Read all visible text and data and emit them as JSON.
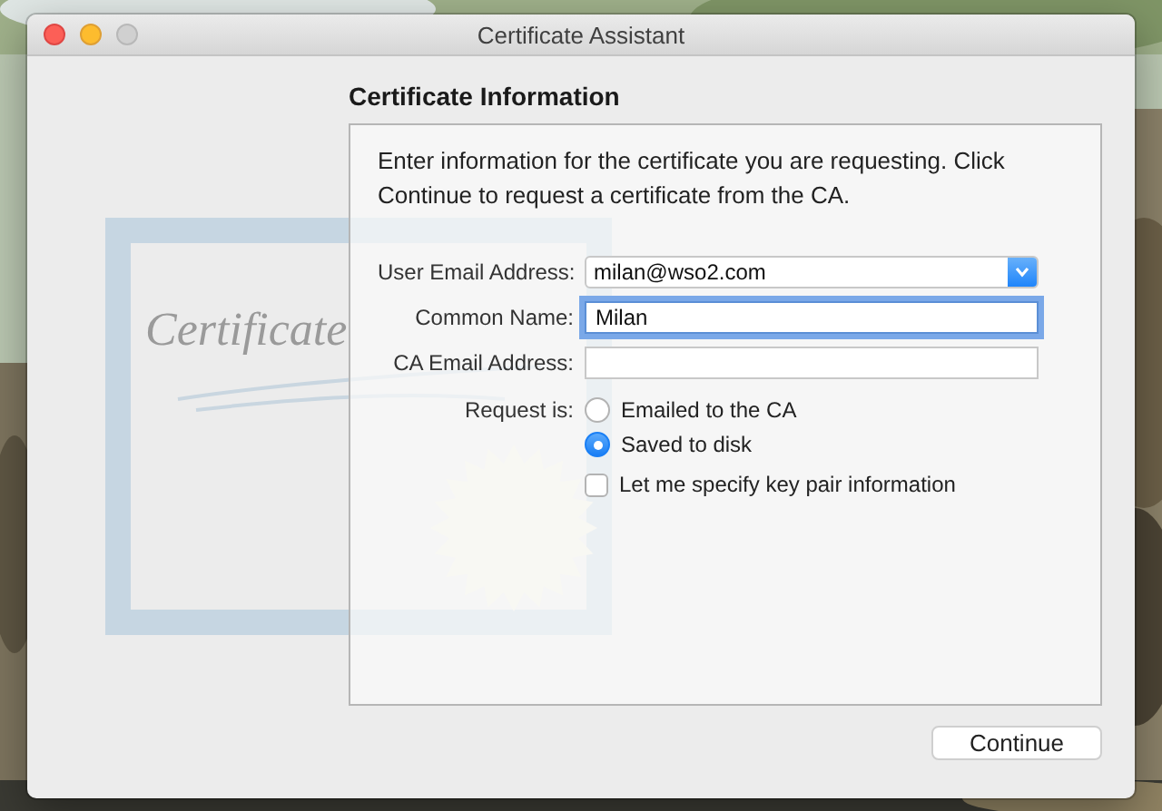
{
  "window": {
    "title": "Certificate Assistant",
    "controls": [
      {
        "kind": "close",
        "disabled": false
      },
      {
        "kind": "minimize",
        "disabled": false
      },
      {
        "kind": "zoom",
        "disabled": true
      }
    ]
  },
  "artwork": {
    "text": "Certificate"
  },
  "section": {
    "title": "Certificate Information",
    "intro": "Enter information for the certificate you are requesting. Click Continue to request a certificate from the CA."
  },
  "fields": [
    {
      "kind": "popup",
      "label": "User Email Address:",
      "value": "milan@wso2.com",
      "focused": false
    },
    {
      "kind": "text",
      "label": "Common Name:",
      "value": "Milan",
      "focused": true
    },
    {
      "kind": "text",
      "label": "CA Email Address:",
      "focused": false
    }
  ],
  "request": {
    "label": "Request is:",
    "options": [
      {
        "label": "Emailed to the CA",
        "selected": false
      },
      {
        "label": "Saved to disk",
        "selected": true
      }
    ]
  },
  "key_pair_option": {
    "label": "Let me specify key pair information",
    "checked": false
  },
  "buttons": [
    {
      "label": "Continue"
    }
  ]
}
